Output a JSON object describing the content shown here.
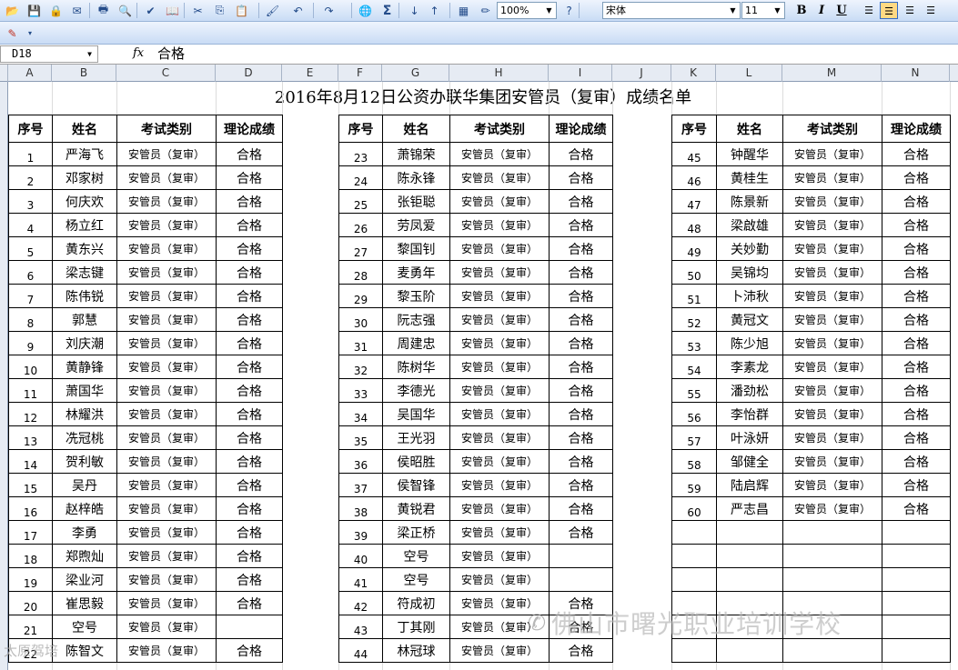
{
  "toolbar": {
    "zoom": "100%",
    "font_name": "宋体",
    "font_size": "11",
    "bold": "B",
    "italic": "I",
    "underline": "U",
    "icons": [
      "folder-open-icon",
      "save-icon",
      "permission-icon",
      "email-icon",
      "print-icon",
      "print-preview-icon",
      "spelling-icon",
      "research-icon",
      "cut-icon",
      "copy-icon",
      "paste-icon",
      "format-painter-icon",
      "undo-icon",
      "redo-icon",
      "hyperlink-icon",
      "autosum-icon",
      "sort-ascending-icon",
      "sort-descending-icon",
      "chart-wizard-icon",
      "drawing-icon",
      "help-icon"
    ]
  },
  "formula_bar": {
    "name_box": "D18",
    "fx": "fx",
    "value": "合格"
  },
  "columns": [
    "A",
    "B",
    "C",
    "D",
    "E",
    "F",
    "G",
    "H",
    "I",
    "J",
    "K",
    "L",
    "M",
    "N"
  ],
  "sheet_title": "2016年8月12日公资办联华集团安管员（复审）成绩名单",
  "headers": [
    "序号",
    "姓名",
    "考试类别",
    "理论成绩"
  ],
  "blocks": [
    {
      "rows": [
        [
          "1",
          "严海飞",
          "安管员（复审）",
          "合格"
        ],
        [
          "2",
          "邓家树",
          "安管员（复审）",
          "合格"
        ],
        [
          "3",
          "何庆欢",
          "安管员（复审）",
          "合格"
        ],
        [
          "4",
          "杨立红",
          "安管员（复审）",
          "合格"
        ],
        [
          "5",
          "黄东兴",
          "安管员（复审）",
          "合格"
        ],
        [
          "6",
          "梁志键",
          "安管员（复审）",
          "合格"
        ],
        [
          "7",
          "陈伟锐",
          "安管员（复审）",
          "合格"
        ],
        [
          "8",
          "郭慧",
          "安管员（复审）",
          "合格"
        ],
        [
          "9",
          "刘庆潮",
          "安管员（复审）",
          "合格"
        ],
        [
          "10",
          "黄静锋",
          "安管员（复审）",
          "合格"
        ],
        [
          "11",
          "萧国华",
          "安管员（复审）",
          "合格"
        ],
        [
          "12",
          "林耀洪",
          "安管员（复审）",
          "合格"
        ],
        [
          "13",
          "冼冠桃",
          "安管员（复审）",
          "合格"
        ],
        [
          "14",
          "贺利敏",
          "安管员（复审）",
          "合格"
        ],
        [
          "15",
          "吴丹",
          "安管员（复审）",
          "合格"
        ],
        [
          "16",
          "赵梓皓",
          "安管员（复审）",
          "合格"
        ],
        [
          "17",
          "李勇",
          "安管员（复审）",
          "合格"
        ],
        [
          "18",
          "郑煦灿",
          "安管员（复审）",
          "合格"
        ],
        [
          "19",
          "梁业河",
          "安管员（复审）",
          "合格"
        ],
        [
          "20",
          "崔思毅",
          "安管员（复审）",
          "合格"
        ],
        [
          "21",
          "空号",
          "安管员（复审）",
          ""
        ],
        [
          "22",
          "陈智文",
          "安管员（复审）",
          "合格"
        ]
      ]
    },
    {
      "rows": [
        [
          "23",
          "萧锦荣",
          "安管员（复审）",
          "合格"
        ],
        [
          "24",
          "陈永锋",
          "安管员（复审）",
          "合格"
        ],
        [
          "25",
          "张钜聪",
          "安管员（复审）",
          "合格"
        ],
        [
          "26",
          "劳凤爱",
          "安管员（复审）",
          "合格"
        ],
        [
          "27",
          "黎国钊",
          "安管员（复审）",
          "合格"
        ],
        [
          "28",
          "麦勇年",
          "安管员（复审）",
          "合格"
        ],
        [
          "29",
          "黎玉阶",
          "安管员（复审）",
          "合格"
        ],
        [
          "30",
          "阮志强",
          "安管员（复审）",
          "合格"
        ],
        [
          "31",
          "周建忠",
          "安管员（复审）",
          "合格"
        ],
        [
          "32",
          "陈树华",
          "安管员（复审）",
          "合格"
        ],
        [
          "33",
          "李德光",
          "安管员（复审）",
          "合格"
        ],
        [
          "34",
          "吴国华",
          "安管员（复审）",
          "合格"
        ],
        [
          "35",
          "王光羽",
          "安管员（复审）",
          "合格"
        ],
        [
          "36",
          "侯昭胜",
          "安管员（复审）",
          "合格"
        ],
        [
          "37",
          "侯智锋",
          "安管员（复审）",
          "合格"
        ],
        [
          "38",
          "黄锐君",
          "安管员（复审）",
          "合格"
        ],
        [
          "39",
          "梁正桥",
          "安管员（复审）",
          "合格"
        ],
        [
          "40",
          "空号",
          "安管员（复审）",
          ""
        ],
        [
          "41",
          "空号",
          "安管员（复审）",
          ""
        ],
        [
          "42",
          "符成初",
          "安管员（复审）",
          "合格"
        ],
        [
          "43",
          "丁其刚",
          "安管员（复审）",
          "合格"
        ],
        [
          "44",
          "林冠球",
          "安管员（复审）",
          "合格"
        ]
      ]
    },
    {
      "rows": [
        [
          "45",
          "钟醒华",
          "安管员（复审）",
          "合格"
        ],
        [
          "46",
          "黄桂生",
          "安管员（复审）",
          "合格"
        ],
        [
          "47",
          "陈景新",
          "安管员（复审）",
          "合格"
        ],
        [
          "48",
          "梁啟雄",
          "安管员（复审）",
          "合格"
        ],
        [
          "49",
          "关妙勤",
          "安管员（复审）",
          "合格"
        ],
        [
          "50",
          "吴锦均",
          "安管员（复审）",
          "合格"
        ],
        [
          "51",
          "卜沛秋",
          "安管员（复审）",
          "合格"
        ],
        [
          "52",
          "黄冠文",
          "安管员（复审）",
          "合格"
        ],
        [
          "53",
          "陈少旭",
          "安管员（复审）",
          "合格"
        ],
        [
          "54",
          "李素龙",
          "安管员（复审）",
          "合格"
        ],
        [
          "55",
          "潘劲松",
          "安管员（复审）",
          "合格"
        ],
        [
          "56",
          "李怡群",
          "安管员（复审）",
          "合格"
        ],
        [
          "57",
          "叶泳妍",
          "安管员（复审）",
          "合格"
        ],
        [
          "58",
          "邹健全",
          "安管员（复审）",
          "合格"
        ],
        [
          "59",
          "陆启辉",
          "安管员（复审）",
          "合格"
        ],
        [
          "60",
          "严志昌",
          "安管员（复审）",
          "合格"
        ],
        [
          "",
          "",
          "",
          ""
        ],
        [
          "",
          "",
          "",
          ""
        ],
        [
          "",
          "",
          "",
          ""
        ],
        [
          "",
          "",
          "",
          ""
        ],
        [
          "",
          "",
          "",
          ""
        ],
        [
          "",
          "",
          "",
          ""
        ]
      ]
    }
  ],
  "watermark": "佛山市曙光职业培训学校",
  "watermark2": "太原驾培"
}
